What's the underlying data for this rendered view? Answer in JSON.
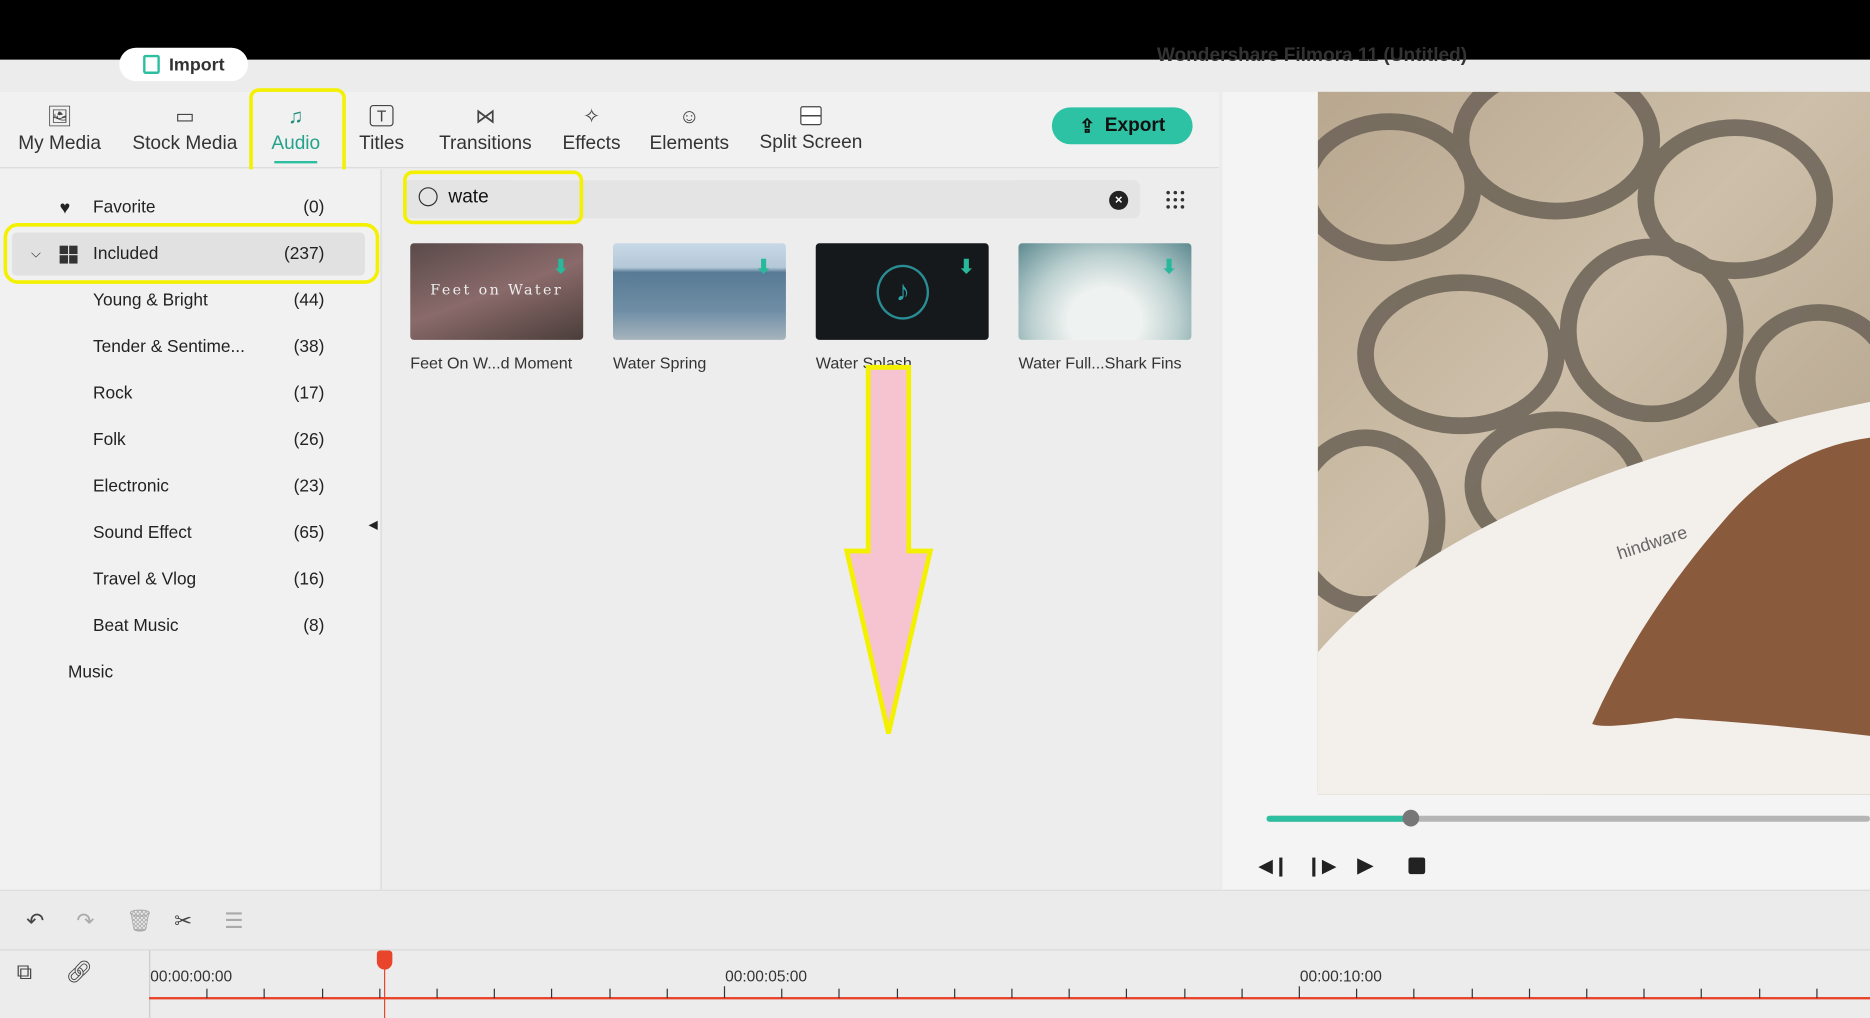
{
  "window": {
    "title": "Wondershare Filmora 11 (Untitled)",
    "import_label": "Import"
  },
  "tabs": [
    {
      "label": "My Media",
      "icon": "image-icon"
    },
    {
      "label": "Stock Media",
      "icon": "cloud-folder-icon"
    },
    {
      "label": "Audio",
      "icon": "music-note-icon",
      "active": true
    },
    {
      "label": "Titles",
      "icon": "text-icon"
    },
    {
      "label": "Transitions",
      "icon": "transition-icon"
    },
    {
      "label": "Effects",
      "icon": "sparkle-icon"
    },
    {
      "label": "Elements",
      "icon": "smiley-icon"
    },
    {
      "label": "Split Screen",
      "icon": "split-screen-icon"
    }
  ],
  "export_label": "Export",
  "sidebar": {
    "favorite": {
      "label": "Favorite",
      "count": "(0)"
    },
    "included": {
      "label": "Included",
      "count": "(237)"
    },
    "items": [
      {
        "label": "Young & Bright",
        "count": "(44)"
      },
      {
        "label": "Tender & Sentime...",
        "count": "(38)"
      },
      {
        "label": "Rock",
        "count": "(17)"
      },
      {
        "label": "Folk",
        "count": "(26)"
      },
      {
        "label": "Electronic",
        "count": "(23)"
      },
      {
        "label": "Sound Effect",
        "count": "(65)"
      },
      {
        "label": "Travel & Vlog",
        "count": "(16)"
      },
      {
        "label": "Beat Music",
        "count": "(8)"
      }
    ],
    "music": "Music"
  },
  "search": {
    "value": "wate"
  },
  "results": [
    {
      "name": "Feet On W...d Moment",
      "thumb_text": "Feet on Water"
    },
    {
      "name": "Water Spring"
    },
    {
      "name": "Water Splash"
    },
    {
      "name": "Water Full...Shark Fins"
    }
  ],
  "video": {
    "watermark": "hindware"
  },
  "player": {
    "progress": 0.24
  },
  "timeline": {
    "labels": [
      "00:00:00:00",
      "00:00:05:00",
      "00:00:10:00"
    ]
  },
  "colors": {
    "accent": "#2dc2a3",
    "highlight": "#f3f000",
    "playhead": "#e8452c"
  }
}
